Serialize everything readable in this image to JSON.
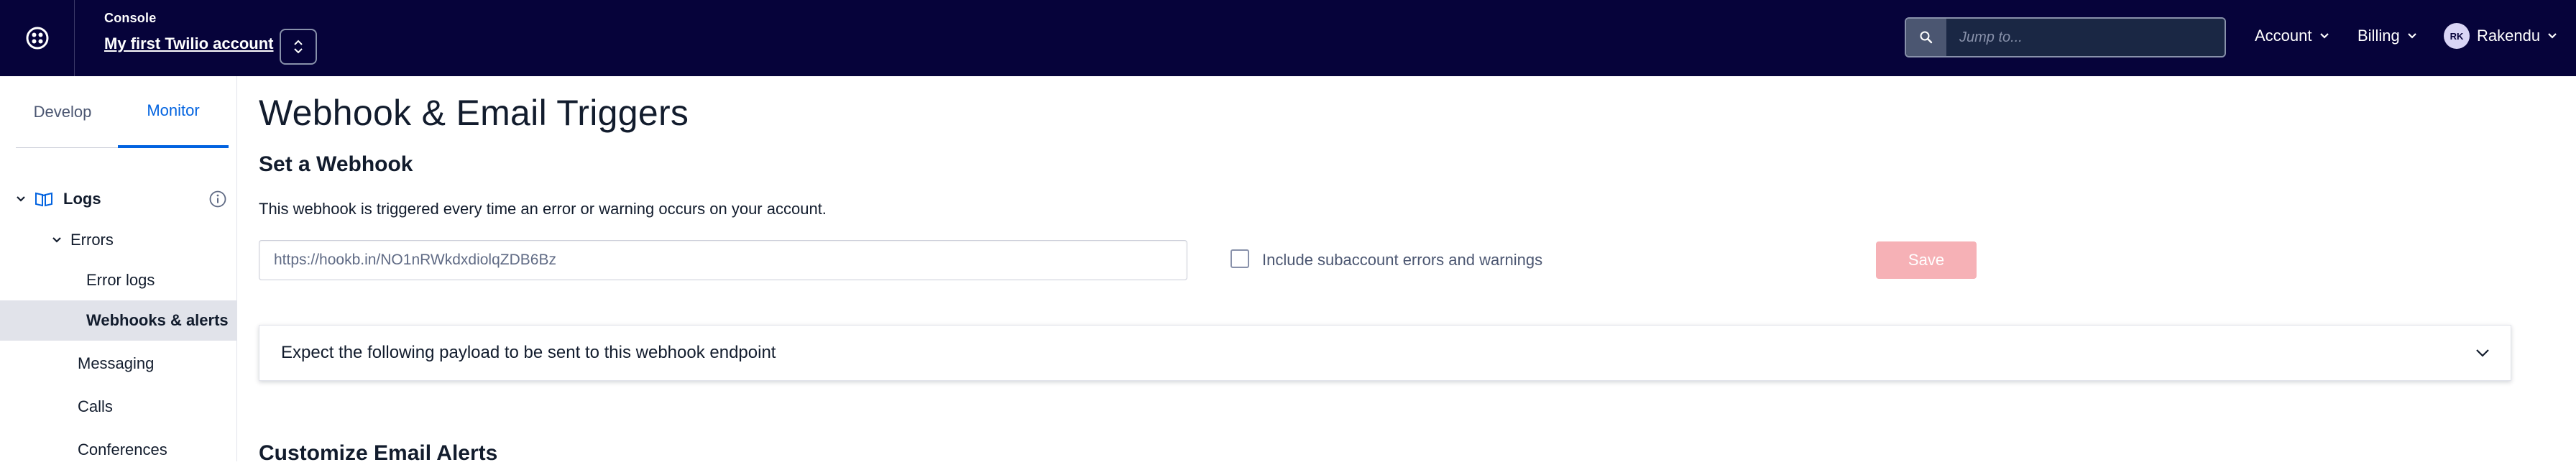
{
  "topbar": {
    "context_label": "Console",
    "account_name": "My first Twilio account",
    "search_placeholder": "Jump to...",
    "menus": [
      "Account",
      "Billing"
    ],
    "user": {
      "initials": "RK",
      "name": "Rakendu"
    }
  },
  "sidebar": {
    "tabs": [
      "Develop",
      "Monitor"
    ],
    "active_tab": "Monitor",
    "logs_label": "Logs",
    "errors_label": "Errors",
    "error_logs_label": "Error logs",
    "webhooks_label": "Webhooks & alerts",
    "messaging_label": "Messaging",
    "calls_label": "Calls",
    "conferences_label": "Conferences"
  },
  "main": {
    "page_title": "Webhook & Email Triggers",
    "section_title": "Set a Webhook",
    "section_desc": "This webhook is triggered every time an error or warning occurs on your account.",
    "webhook_url": "https://hookb.in/NO1nRWkdxdiolqZDB6Bz",
    "checkbox_label": "Include subaccount errors and warnings",
    "save_label": "Save",
    "accordion_label": "Expect the following payload to be sent to this webhook endpoint",
    "section2_title": "Customize Email Alerts"
  },
  "colors": {
    "topbar_bg": "#06033a",
    "accent": "#0263e0",
    "save_disabled": "#f6b1b6",
    "active_row": "#e1e3ea"
  }
}
